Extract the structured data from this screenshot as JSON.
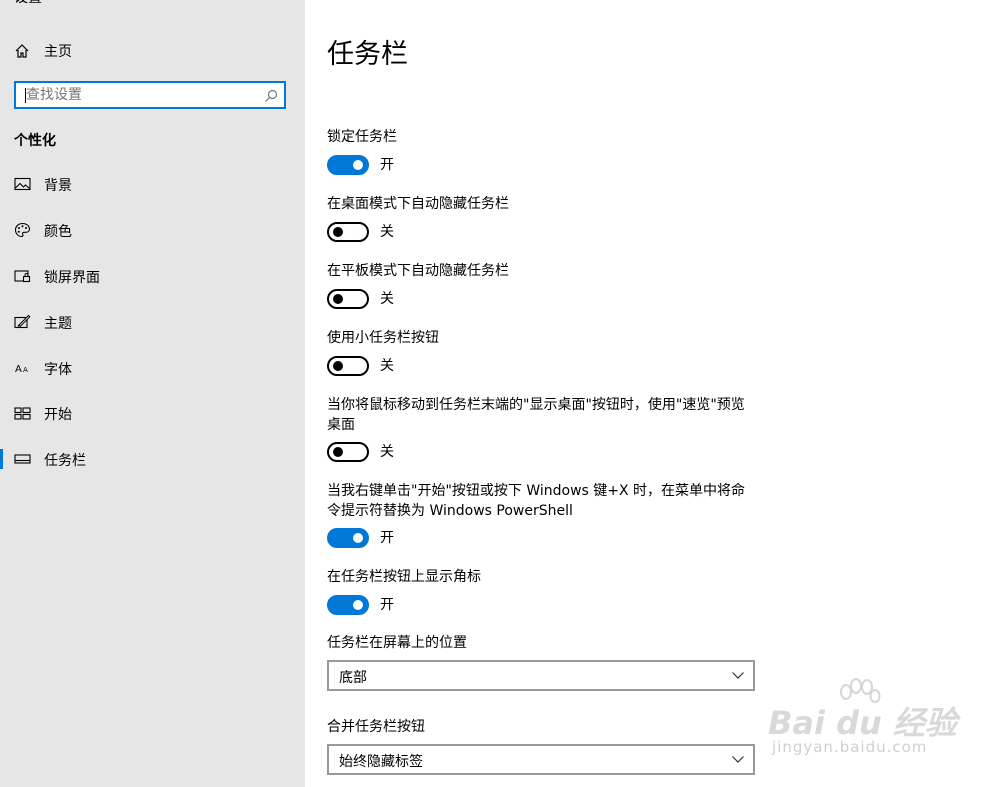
{
  "sidebar": {
    "title_fragment": "设置",
    "home_label": "主页",
    "search": {
      "placeholder": "查找设置",
      "value": ""
    },
    "section_title": "个性化",
    "items": [
      {
        "label": "背景",
        "icon": "picture-icon"
      },
      {
        "label": "颜色",
        "icon": "palette-icon"
      },
      {
        "label": "锁屏界面",
        "icon": "lock-screen-icon"
      },
      {
        "label": "主题",
        "icon": "theme-brush-icon"
      },
      {
        "label": "字体",
        "icon": "font-icon"
      },
      {
        "label": "开始",
        "icon": "start-tiles-icon"
      },
      {
        "label": "任务栏",
        "icon": "taskbar-icon",
        "selected": true
      }
    ]
  },
  "main": {
    "title": "任务栏",
    "settings": [
      {
        "label": "锁定任务栏",
        "state": "开",
        "on": true
      },
      {
        "label": "在桌面模式下自动隐藏任务栏",
        "state": "关",
        "on": false
      },
      {
        "label": "在平板模式下自动隐藏任务栏",
        "state": "关",
        "on": false
      },
      {
        "label": "使用小任务栏按钮",
        "state": "关",
        "on": false
      },
      {
        "label": "当你将鼠标移动到任务栏末端的\"显示桌面\"按钮时，使用\"速览\"预览桌面",
        "state": "关",
        "on": false
      },
      {
        "label": "当我右键单击\"开始\"按钮或按下 Windows 键+X 时，在菜单中将命令提示符替换为 Windows PowerShell",
        "state": "开",
        "on": true
      },
      {
        "label": "在任务栏按钮上显示角标",
        "state": "开",
        "on": true
      }
    ],
    "position": {
      "label": "任务栏在屏幕上的位置",
      "value": "底部"
    },
    "combine": {
      "label": "合并任务栏按钮",
      "value": "始终隐藏标签"
    }
  },
  "watermark": {
    "brand": "Bai du 经验",
    "url": "jingyan.baidu.com"
  },
  "colors": {
    "accent": "#0078d7",
    "sidebar_bg": "#e6e6e6",
    "main_bg": "#ffffff"
  }
}
